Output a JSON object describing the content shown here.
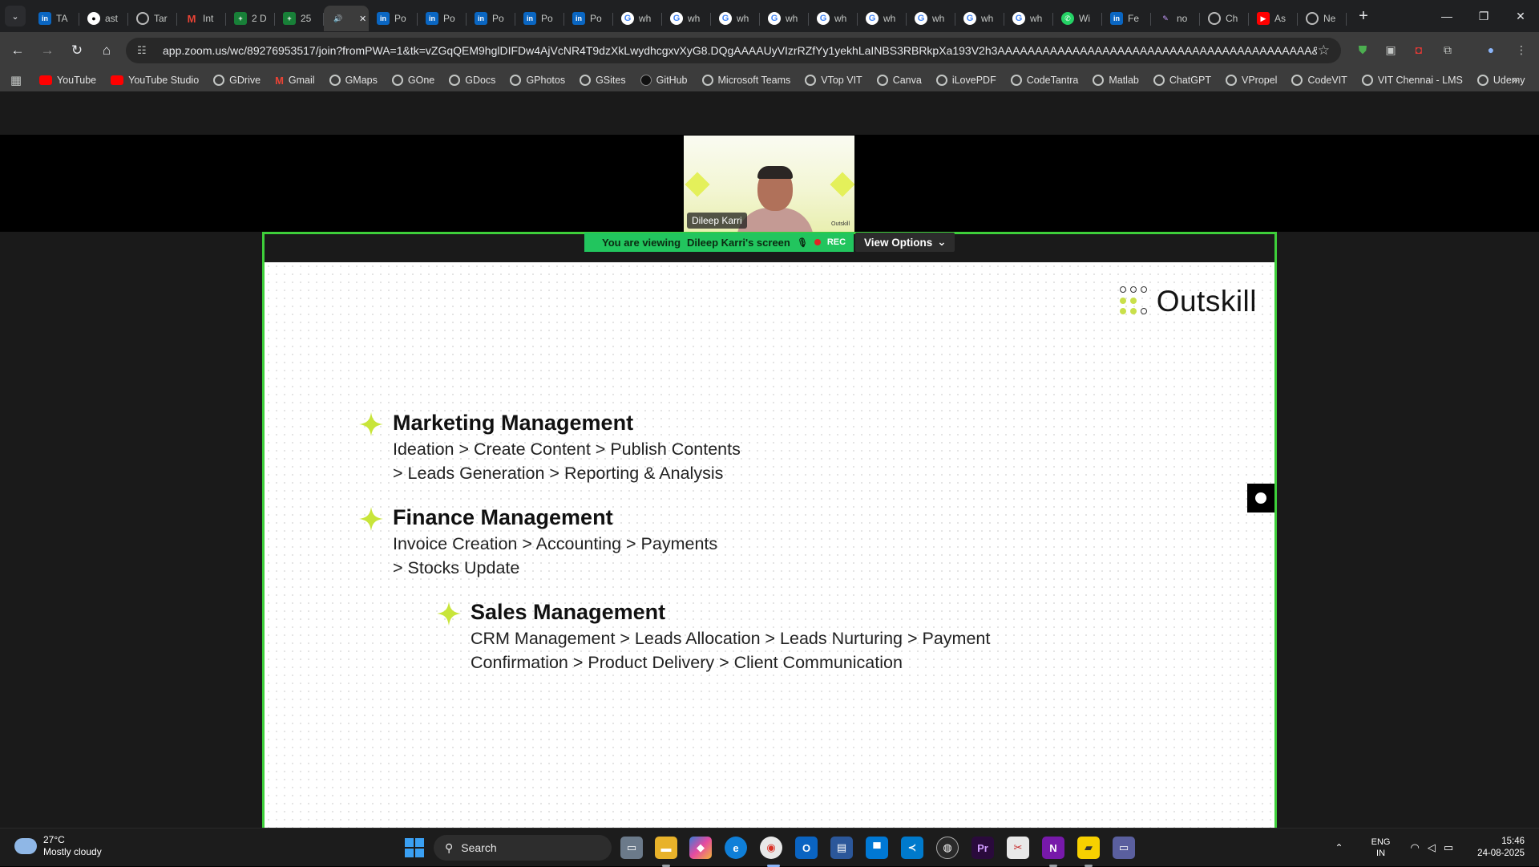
{
  "browser": {
    "tabs": [
      {
        "label": "TA",
        "favicon": "linkedin-icon"
      },
      {
        "label": "ast",
        "favicon": "github-icon"
      },
      {
        "label": "Tar",
        "favicon": "globe-icon"
      },
      {
        "label": "Int",
        "favicon": "gmail-icon"
      },
      {
        "label": "2 D",
        "favicon": "sheets-icon"
      },
      {
        "label": "25",
        "favicon": "sheets-icon"
      },
      {
        "label": "",
        "favicon": "speaker-icon",
        "active": true
      },
      {
        "label": "Po",
        "favicon": "linkedin-icon"
      },
      {
        "label": "Po",
        "favicon": "linkedin-icon"
      },
      {
        "label": "Po",
        "favicon": "linkedin-icon"
      },
      {
        "label": "Po",
        "favicon": "linkedin-icon"
      },
      {
        "label": "Po",
        "favicon": "linkedin-icon"
      },
      {
        "label": "wh",
        "favicon": "google-icon"
      },
      {
        "label": "wh",
        "favicon": "google-icon"
      },
      {
        "label": "wh",
        "favicon": "google-icon"
      },
      {
        "label": "wh",
        "favicon": "google-icon"
      },
      {
        "label": "wh",
        "favicon": "google-icon"
      },
      {
        "label": "wh",
        "favicon": "google-icon"
      },
      {
        "label": "wh",
        "favicon": "google-icon"
      },
      {
        "label": "wh",
        "favicon": "google-icon"
      },
      {
        "label": "wh",
        "favicon": "google-icon"
      },
      {
        "label": "Wi",
        "favicon": "whatsapp-icon"
      },
      {
        "label": "Fe",
        "favicon": "linkedin-icon"
      },
      {
        "label": "no",
        "favicon": "claude-icon"
      },
      {
        "label": "Ch",
        "favicon": "openai-icon"
      },
      {
        "label": "As",
        "favicon": "youtube-icon"
      },
      {
        "label": "Ne",
        "favicon": "globe-icon"
      }
    ],
    "url": "app.zoom.us/wc/89276953517/join?fromPWA=1&tk=vZGqQEM9hglDIFDw4AjVcNR4T9dzXkLwydhcgxvXyG8.DQgAAAAUyVIzrRZfYy1yekhLaINBS3RBRkpXa193V2h3AAAAAAAAAAAAAAAAAAAAAAAAAAAAAAAAAAAAAAAAAA&_x_zm_r...",
    "bookmarks": [
      "YouTube",
      "YouTube Studio",
      "GDrive",
      "Gmail",
      "GMaps",
      "GOne",
      "GDocs",
      "GPhotos",
      "GSites",
      "GitHub",
      "Microsoft Teams",
      "VTop VIT",
      "Canva",
      "iLovePDF",
      "CodeTantra",
      "Matlab",
      "ChatGPT",
      "VPropel",
      "CodeVIT",
      "VIT Chennai - LMS",
      "Udemy"
    ]
  },
  "zoom": {
    "participant_name": "Dileep Karri",
    "video_brand": "Outskill",
    "banner_prefix": "You are viewing",
    "banner_presenter": "Dileep Karri's screen",
    "rec_label": "REC",
    "view_options_label": "View Options",
    "accent_color": "#22c55e"
  },
  "slide": {
    "brand": "Outskill",
    "items": [
      {
        "title": "Marketing Management",
        "lines": [
          "Ideation > Create Content > Publish Contents",
          "> Leads Generation > Reporting & Analysis"
        ]
      },
      {
        "title": "Finance Management",
        "lines": [
          "Invoice Creation > Accounting > Payments",
          "> Stocks Update"
        ]
      },
      {
        "title": "Sales Management",
        "lines": [
          "CRM Management > Leads Allocation > Leads Nurturing > Payment",
          "Confirmation > Product Delivery > Client Communication"
        ]
      }
    ],
    "star_color": "#c8e53a"
  },
  "taskbar": {
    "weather_temp": "27°C",
    "weather_cond": "Mostly cloudy",
    "search_label": "Search",
    "lang_top": "ENG",
    "lang_bottom": "IN",
    "time": "15:46",
    "date": "24-08-2025"
  }
}
